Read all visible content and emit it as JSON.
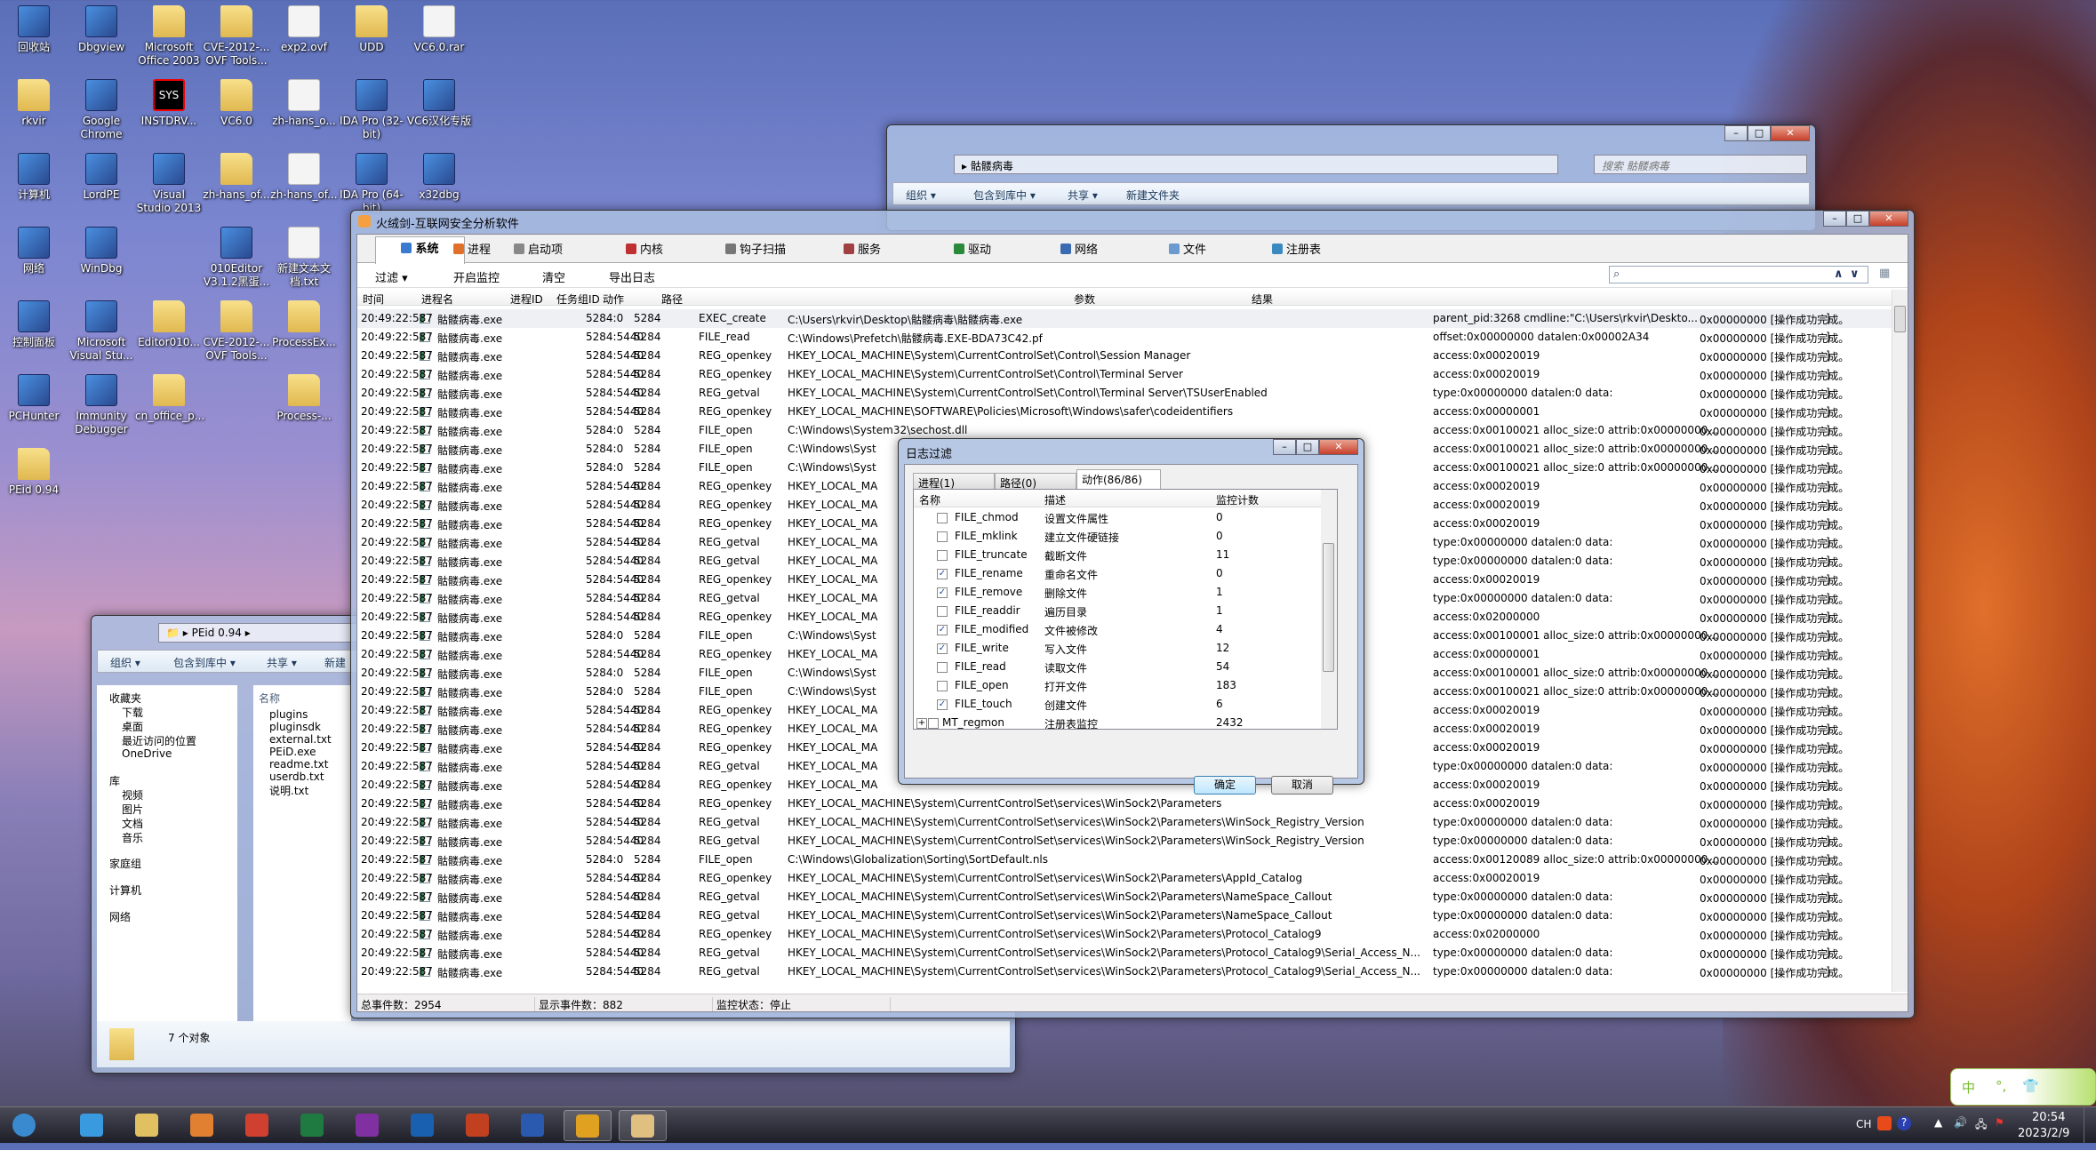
{
  "colors": {
    "accent": "#3c7fb1",
    "wallpaper": "#7b86d0"
  },
  "desktop_icons": [
    {
      "label": "回收站",
      "icon": "recycle-bin-icon",
      "type": "app"
    },
    {
      "label": "Dbgview",
      "icon": "dbgview-icon",
      "type": "app"
    },
    {
      "label": "Microsoft Office 2003",
      "icon": "folder-icon",
      "type": "folder"
    },
    {
      "label": "CVE-2012-... OVF Tools...",
      "icon": "folder-icon",
      "type": "folder"
    },
    {
      "label": "exp2.ovf",
      "icon": "file-icon",
      "type": "file"
    },
    {
      "label": "UDD",
      "icon": "folder-icon",
      "type": "folder"
    },
    {
      "label": "VC6.0.rar",
      "icon": "file-icon",
      "type": "file"
    },
    {
      "label": "rkvir",
      "icon": "user-folder-icon",
      "type": "folder"
    },
    {
      "label": "Google Chrome",
      "icon": "chrome-icon",
      "type": "app"
    },
    {
      "label": "INSTDRV...",
      "icon": "sys-icon",
      "type": "sys"
    },
    {
      "label": "VC6.0",
      "icon": "folder-icon",
      "type": "folder"
    },
    {
      "label": "zh-hans_o...",
      "icon": "disc-image-icon",
      "type": "file"
    },
    {
      "label": "IDA Pro (32-bit)",
      "icon": "ida-icon",
      "type": "app"
    },
    {
      "label": "VC6汉化专版",
      "icon": "vc6-icon",
      "type": "app"
    },
    {
      "label": "计算机",
      "icon": "computer-icon",
      "type": "app"
    },
    {
      "label": "LordPE",
      "icon": "lordpe-icon",
      "type": "app"
    },
    {
      "label": "Visual Studio 2013",
      "icon": "visual-studio-icon",
      "type": "app"
    },
    {
      "label": "zh-hans_of...",
      "icon": "folder-icon",
      "type": "folder"
    },
    {
      "label": "zh-hans_of...",
      "icon": "disc-image-icon",
      "type": "file"
    },
    {
      "label": "IDA Pro (64-bit)",
      "icon": "ida-icon",
      "type": "app"
    },
    {
      "label": "x32dbg",
      "icon": "x32dbg-icon",
      "type": "app"
    },
    {
      "label": "网络",
      "icon": "network-icon",
      "type": "app"
    },
    {
      "label": "WinDbg",
      "icon": "windbg-icon",
      "type": "app"
    },
    null,
    {
      "label": "010Editor V3.1.2黑蛋...",
      "icon": "010editor-icon",
      "type": "app"
    },
    {
      "label": "新建文本文档.txt",
      "icon": "text-file-icon",
      "type": "file"
    },
    null,
    null,
    {
      "label": "控制面板",
      "icon": "control-panel-icon",
      "type": "app"
    },
    {
      "label": "Microsoft Visual Stu...",
      "icon": "visual-studio-icon",
      "type": "app"
    },
    {
      "label": "Editor010...",
      "icon": "folder-icon",
      "type": "folder"
    },
    {
      "label": "CVE-2012-... OVF Tools...",
      "icon": "zip-folder-icon",
      "type": "folder"
    },
    {
      "label": "ProcessEx...",
      "icon": "folder-icon",
      "type": "folder"
    },
    null,
    null,
    {
      "label": "PCHunter",
      "icon": "pchunter-icon",
      "type": "app"
    },
    {
      "label": "Immunity Debugger",
      "icon": "immunity-icon",
      "type": "app"
    },
    {
      "label": "cn_office_p...",
      "icon": "folder-icon",
      "type": "folder"
    },
    null,
    {
      "label": "Process-...",
      "icon": "folder-icon",
      "type": "folder"
    },
    null,
    null,
    {
      "label": "PEid 0.94",
      "icon": "folder-icon",
      "type": "folder"
    }
  ],
  "explorer_back": {
    "address": "骷髅病毒",
    "search_placeholder": "搜索 骷髅病毒",
    "toolbar": [
      "组织 ▾",
      "包含到库中 ▾",
      "共享 ▾",
      "新建文件夹"
    ]
  },
  "explorer_peid": {
    "address": "PEid 0.94",
    "toolbar": [
      "组织 ▾",
      "包含到库中 ▾",
      "共享 ▾",
      "新建"
    ],
    "nav": [
      {
        "label": "收藏夹",
        "indent": 0
      },
      {
        "label": "下载",
        "indent": 1
      },
      {
        "label": "桌面",
        "indent": 1
      },
      {
        "label": "最近访问的位置",
        "indent": 1
      },
      {
        "label": "OneDrive",
        "indent": 1
      },
      {
        "label": "库",
        "indent": 0
      },
      {
        "label": "视频",
        "indent": 1
      },
      {
        "label": "图片",
        "indent": 1
      },
      {
        "label": "文档",
        "indent": 1
      },
      {
        "label": "音乐",
        "indent": 1
      },
      {
        "label": "家庭组",
        "indent": 0
      },
      {
        "label": "计算机",
        "indent": 0
      },
      {
        "label": "网络",
        "indent": 0
      }
    ],
    "column": "名称",
    "files": [
      "plugins",
      "pluginsdk",
      "external.txt",
      "PEiD.exe",
      "readme.txt",
      "userdb.txt",
      "说明.txt"
    ],
    "status": "7 个对象"
  },
  "main": {
    "title": "火绒剑-互联网安全分析软件",
    "tabs": [
      "系统",
      "进程",
      "启动项",
      "内核",
      "钩子扫描",
      "服务",
      "驱动",
      "网络",
      "文件",
      "注册表"
    ],
    "active_tab": "系统",
    "toolbar": {
      "filter": "过滤 ▾",
      "start": "开启监控",
      "clear": "清空",
      "export": "导出日志"
    },
    "search": {
      "value": "",
      "up": "∧",
      "down": "∨"
    },
    "columns": [
      "时间",
      "进程名",
      "进程ID",
      "任务组ID",
      "动作",
      "路径",
      "参数",
      "结果"
    ],
    "rows": [
      [
        "20:49:22:587",
        "骷髅病毒.exe",
        "5284:0",
        "5284",
        "EXEC_create",
        "C:\\Users\\rkvir\\Desktop\\骷髅病毒\\骷髅病毒.exe",
        "parent_pid:3268 cmdline:\"C:\\Users\\rkvir\\Deskto...",
        "0x00000000 [操作成功完成。",
        "]"
      ],
      [
        "20:49:22:587",
        "骷髅病毒.exe",
        "5284:5440",
        "5284",
        "FILE_read",
        "C:\\Windows\\Prefetch\\骷髅病毒.EXE-BDA73C42.pf",
        "offset:0x00000000 datalen:0x00002A34",
        "0x00000000 [操作成功完成。",
        "]"
      ],
      [
        "20:49:22:587",
        "骷髅病毒.exe",
        "5284:5440",
        "5284",
        "REG_openkey",
        "HKEY_LOCAL_MACHINE\\System\\CurrentControlSet\\Control\\Session Manager",
        "access:0x00020019",
        "0x00000000 [操作成功完成。",
        "]"
      ],
      [
        "20:49:22:587",
        "骷髅病毒.exe",
        "5284:5440",
        "5284",
        "REG_openkey",
        "HKEY_LOCAL_MACHINE\\System\\CurrentControlSet\\Control\\Terminal Server",
        "access:0x00020019",
        "0x00000000 [操作成功完成。",
        "]"
      ],
      [
        "20:49:22:587",
        "骷髅病毒.exe",
        "5284:5440",
        "5284",
        "REG_getval",
        "HKEY_LOCAL_MACHINE\\System\\CurrentControlSet\\Control\\Terminal Server\\TSUserEnabled",
        "type:0x00000000 datalen:0 data:",
        "0x00000000 [操作成功完成。",
        "]"
      ],
      [
        "20:49:22:587",
        "骷髅病毒.exe",
        "5284:5440",
        "5284",
        "REG_openkey",
        "HKEY_LOCAL_MACHINE\\SOFTWARE\\Policies\\Microsoft\\Windows\\safer\\codeidentifiers",
        "access:0x00000001",
        "0x00000000 [操作成功完成。",
        "]"
      ],
      [
        "20:49:22:587",
        "骷髅病毒.exe",
        "5284:0",
        "5284",
        "FILE_open",
        "C:\\Windows\\System32\\sechost.dll",
        "access:0x00100021 alloc_size:0 attrib:0x00000000...",
        "0x00000000 [操作成功完成。",
        "]"
      ],
      [
        "20:49:22:587",
        "骷髅病毒.exe",
        "5284:0",
        "5284",
        "FILE_open",
        "C:\\Windows\\Syst",
        "access:0x00100021 alloc_size:0 attrib:0x00000000...",
        "0x00000000 [操作成功完成。",
        "]"
      ],
      [
        "20:49:22:587",
        "骷髅病毒.exe",
        "5284:0",
        "5284",
        "FILE_open",
        "C:\\Windows\\Syst",
        "access:0x00100021 alloc_size:0 attrib:0x00000000...",
        "0x00000000 [操作成功完成。",
        "]"
      ],
      [
        "20:49:22:587",
        "骷髅病毒.exe",
        "5284:5440",
        "5284",
        "REG_openkey",
        "HKEY_LOCAL_MA",
        "access:0x00020019",
        "0x00000000 [操作成功完成。",
        "]"
      ],
      [
        "20:49:22:587",
        "骷髅病毒.exe",
        "5284:5440",
        "5284",
        "REG_openkey",
        "HKEY_LOCAL_MA",
        "access:0x00020019",
        "0x00000000 [操作成功完成。",
        "]"
      ],
      [
        "20:49:22:587",
        "骷髅病毒.exe",
        "5284:5440",
        "5284",
        "REG_openkey",
        "HKEY_LOCAL_MA",
        "access:0x00020019",
        "0x00000000 [操作成功完成。",
        "]"
      ],
      [
        "20:49:22:587",
        "骷髅病毒.exe",
        "5284:5440",
        "5284",
        "REG_getval",
        "HKEY_LOCAL_MA",
        "type:0x00000000 datalen:0 data:",
        "0x00000000 [操作成功完成。",
        "]"
      ],
      [
        "20:49:22:587",
        "骷髅病毒.exe",
        "5284:5440",
        "5284",
        "REG_getval",
        "HKEY_LOCAL_MA",
        "type:0x00000000 datalen:0 data:",
        "0x00000000 [操作成功完成。",
        "]"
      ],
      [
        "20:49:22:587",
        "骷髅病毒.exe",
        "5284:5440",
        "5284",
        "REG_openkey",
        "HKEY_LOCAL_MA",
        "access:0x00020019",
        "0x00000000 [操作成功完成。",
        "]"
      ],
      [
        "20:49:22:587",
        "骷髅病毒.exe",
        "5284:5440",
        "5284",
        "REG_getval",
        "HKEY_LOCAL_MA",
        "type:0x00000000 datalen:0 data:",
        "0x00000000 [操作成功完成。",
        "]"
      ],
      [
        "20:49:22:587",
        "骷髅病毒.exe",
        "5284:5440",
        "5284",
        "REG_openkey",
        "HKEY_LOCAL_MA",
        "access:0x02000000",
        "0x00000000 [操作成功完成。",
        "]"
      ],
      [
        "20:49:22:587",
        "骷髅病毒.exe",
        "5284:0",
        "5284",
        "FILE_open",
        "C:\\Windows\\Syst",
        "access:0x00100001 alloc_size:0 attrib:0x00000000...",
        "0x00000000 [操作成功完成。",
        "]"
      ],
      [
        "20:49:22:587",
        "骷髅病毒.exe",
        "5284:5440",
        "5284",
        "REG_openkey",
        "HKEY_LOCAL_MA",
        "access:0x00000001",
        "0x00000000 [操作成功完成。",
        "]"
      ],
      [
        "20:49:22:587",
        "骷髅病毒.exe",
        "5284:0",
        "5284",
        "FILE_open",
        "C:\\Windows\\Syst",
        "access:0x00100001 alloc_size:0 attrib:0x00000000...",
        "0x00000000 [操作成功完成。",
        "]"
      ],
      [
        "20:49:22:587",
        "骷髅病毒.exe",
        "5284:0",
        "5284",
        "FILE_open",
        "C:\\Windows\\Syst",
        "access:0x00100021 alloc_size:0 attrib:0x00000000...",
        "0x00000000 [操作成功完成。",
        "]"
      ],
      [
        "20:49:22:587",
        "骷髅病毒.exe",
        "5284:5440",
        "5284",
        "REG_openkey",
        "HKEY_LOCAL_MA",
        "access:0x00020019",
        "0x00000000 [操作成功完成。",
        "]"
      ],
      [
        "20:49:22:587",
        "骷髅病毒.exe",
        "5284:5440",
        "5284",
        "REG_openkey",
        "HKEY_LOCAL_MA",
        "access:0x00020019",
        "0x00000000 [操作成功完成。",
        "]"
      ],
      [
        "20:49:22:587",
        "骷髅病毒.exe",
        "5284:5440",
        "5284",
        "REG_openkey",
        "HKEY_LOCAL_MA",
        "access:0x00020019",
        "0x00000000 [操作成功完成。",
        "]"
      ],
      [
        "20:49:22:587",
        "骷髅病毒.exe",
        "5284:5440",
        "5284",
        "REG_getval",
        "HKEY_LOCAL_MA",
        "type:0x00000000 datalen:0 data:",
        "0x00000000 [操作成功完成。",
        "]"
      ],
      [
        "20:49:22:587",
        "骷髅病毒.exe",
        "5284:5440",
        "5284",
        "REG_openkey",
        "HKEY_LOCAL_MA",
        "access:0x00020019",
        "0x00000000 [操作成功完成。",
        "]"
      ],
      [
        "20:49:22:587",
        "骷髅病毒.exe",
        "5284:5440",
        "5284",
        "REG_openkey",
        "HKEY_LOCAL_MACHINE\\System\\CurrentControlSet\\services\\WinSock2\\Parameters",
        "access:0x00020019",
        "0x00000000 [操作成功完成。",
        "]"
      ],
      [
        "20:49:22:587",
        "骷髅病毒.exe",
        "5284:5440",
        "5284",
        "REG_getval",
        "HKEY_LOCAL_MACHINE\\System\\CurrentControlSet\\services\\WinSock2\\Parameters\\WinSock_Registry_Version",
        "type:0x00000000 datalen:0 data:",
        "0x00000000 [操作成功完成。",
        "]"
      ],
      [
        "20:49:22:587",
        "骷髅病毒.exe",
        "5284:5440",
        "5284",
        "REG_getval",
        "HKEY_LOCAL_MACHINE\\System\\CurrentControlSet\\services\\WinSock2\\Parameters\\WinSock_Registry_Version",
        "type:0x00000000 datalen:0 data:",
        "0x00000000 [操作成功完成。",
        "]"
      ],
      [
        "20:49:22:587",
        "骷髅病毒.exe",
        "5284:0",
        "5284",
        "FILE_open",
        "C:\\Windows\\Globalization\\Sorting\\SortDefault.nls",
        "access:0x00120089 alloc_size:0 attrib:0x00000000...",
        "0x00000000 [操作成功完成。",
        "]"
      ],
      [
        "20:49:22:587",
        "骷髅病毒.exe",
        "5284:5440",
        "5284",
        "REG_openkey",
        "HKEY_LOCAL_MACHINE\\System\\CurrentControlSet\\services\\WinSock2\\Parameters\\AppId_Catalog",
        "access:0x00020019",
        "0x00000000 [操作成功完成。",
        "]"
      ],
      [
        "20:49:22:587",
        "骷髅病毒.exe",
        "5284:5440",
        "5284",
        "REG_getval",
        "HKEY_LOCAL_MACHINE\\System\\CurrentControlSet\\services\\WinSock2\\Parameters\\NameSpace_Callout",
        "type:0x00000000 datalen:0 data:",
        "0x00000000 [操作成功完成。",
        "]"
      ],
      [
        "20:49:22:587",
        "骷髅病毒.exe",
        "5284:5440",
        "5284",
        "REG_getval",
        "HKEY_LOCAL_MACHINE\\System\\CurrentControlSet\\services\\WinSock2\\Parameters\\NameSpace_Callout",
        "type:0x00000000 datalen:0 data:",
        "0x00000000 [操作成功完成。",
        "]"
      ],
      [
        "20:49:22:587",
        "骷髅病毒.exe",
        "5284:5440",
        "5284",
        "REG_openkey",
        "HKEY_LOCAL_MACHINE\\System\\CurrentControlSet\\services\\WinSock2\\Parameters\\Protocol_Catalog9",
        "access:0x02000000",
        "0x00000000 [操作成功完成。",
        "]"
      ],
      [
        "20:49:22:587",
        "骷髅病毒.exe",
        "5284:5440",
        "5284",
        "REG_getval",
        "HKEY_LOCAL_MACHINE\\System\\CurrentControlSet\\services\\WinSock2\\Parameters\\Protocol_Catalog9\\Serial_Access_N...",
        "type:0x00000000 datalen:0 data:",
        "0x00000000 [操作成功完成。",
        "]"
      ],
      [
        "20:49:22:587",
        "骷髅病毒.exe",
        "5284:5440",
        "5284",
        "REG_getval",
        "HKEY_LOCAL_MACHINE\\System\\CurrentControlSet\\services\\WinSock2\\Parameters\\Protocol_Catalog9\\Serial_Access_N...",
        "type:0x00000000 datalen:0 data:",
        "0x00000000 [操作成功完成。",
        "]"
      ]
    ],
    "status": {
      "total": "总事件数：2954",
      "shown": "显示事件数：882",
      "monitor": "监控状态：停止"
    }
  },
  "dialog": {
    "title": "日志过滤",
    "tabs": [
      "进程(1)",
      "路径(0)",
      "动作(86/86)"
    ],
    "active_tab": "动作(86/86)",
    "columns": [
      "名称",
      "描述",
      "监控计数"
    ],
    "items": [
      {
        "name": "FILE_chmod",
        "desc": "设置文件属性",
        "count": "0",
        "checked": false
      },
      {
        "name": "FILE_mklink",
        "desc": "建立文件硬链接",
        "count": "0",
        "checked": false
      },
      {
        "name": "FILE_truncate",
        "desc": "截断文件",
        "count": "11",
        "checked": false
      },
      {
        "name": "FILE_rename",
        "desc": "重命名文件",
        "count": "0",
        "checked": true
      },
      {
        "name": "FILE_remove",
        "desc": "删除文件",
        "count": "1",
        "checked": true
      },
      {
        "name": "FILE_readdir",
        "desc": "遍历目录",
        "count": "1",
        "checked": false
      },
      {
        "name": "FILE_modified",
        "desc": "文件被修改",
        "count": "4",
        "checked": true
      },
      {
        "name": "FILE_write",
        "desc": "写入文件",
        "count": "12",
        "checked": true
      },
      {
        "name": "FILE_read",
        "desc": "读取文件",
        "count": "54",
        "checked": false
      },
      {
        "name": "FILE_open",
        "desc": "打开文件",
        "count": "183",
        "checked": false
      },
      {
        "name": "FILE_touch",
        "desc": "创建文件",
        "count": "6",
        "checked": true
      },
      {
        "name": "MT_regmon",
        "desc": "注册表监控",
        "count": "2432",
        "checked": false,
        "group": true
      }
    ],
    "ok": "确定",
    "cancel": "取消"
  },
  "taskbar": {
    "apps": [
      "start-icon",
      "ie-icon",
      "explorer-icon",
      "media-player-icon",
      "chrome-icon",
      "excel-icon",
      "onenote-icon",
      "outlook-icon",
      "powerpoint-icon",
      "word-icon",
      "huorong-icon",
      "huorong-sword-icon"
    ],
    "lang": "CH",
    "time": "20:54",
    "date": "2023/2/9",
    "ime": [
      "中",
      "°,",
      "👕"
    ]
  }
}
